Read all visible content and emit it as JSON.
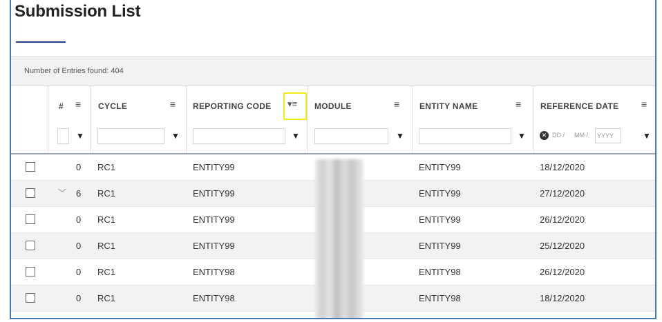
{
  "page": {
    "title": "Submission List"
  },
  "entries": {
    "label": "Number of Entries found:",
    "count": "404"
  },
  "columns": [
    {
      "key": "num",
      "label": "#"
    },
    {
      "key": "cycle",
      "label": "CYCLE"
    },
    {
      "key": "reporting_code",
      "label": "REPORTING CODE"
    },
    {
      "key": "module",
      "label": "MODULE"
    },
    {
      "key": "entity_name",
      "label": "ENTITY NAME"
    },
    {
      "key": "reference_date",
      "label": "REFERENCE DATE"
    }
  ],
  "date_filter": {
    "dd": "DD",
    "mm": "MM",
    "yyyy": "YYYY",
    "sep": "/"
  },
  "icons": {
    "menu": "menu-lines-icon",
    "filter": "funnel-icon",
    "sort_menu": "sort-menu-icon",
    "expand": "chevron-down-icon",
    "clear": "clear-circle-icon"
  },
  "rows": [
    {
      "num": "0",
      "cycle": "RC1",
      "reporting_code": "ENTITY99",
      "entity_name": "ENTITY99",
      "reference_date": "18/12/2020",
      "expandable": false
    },
    {
      "num": "6",
      "cycle": "RC1",
      "reporting_code": "ENTITY99",
      "entity_name": "ENTITY99",
      "reference_date": "27/12/2020",
      "expandable": true
    },
    {
      "num": "0",
      "cycle": "RC1",
      "reporting_code": "ENTITY99",
      "entity_name": "ENTITY99",
      "reference_date": "26/12/2020",
      "expandable": false
    },
    {
      "num": "0",
      "cycle": "RC1",
      "reporting_code": "ENTITY99",
      "entity_name": "ENTITY99",
      "reference_date": "25/12/2020",
      "expandable": false
    },
    {
      "num": "0",
      "cycle": "RC1",
      "reporting_code": "ENTITY98",
      "entity_name": "ENTITY98",
      "reference_date": "26/12/2020",
      "expandable": false
    },
    {
      "num": "0",
      "cycle": "RC1",
      "reporting_code": "ENTITY98",
      "entity_name": "ENTITY98",
      "reference_date": "18/12/2020",
      "expandable": false
    }
  ],
  "colors": {
    "frame_border": "#4a77b4",
    "title_underline": "#1f3f8a",
    "highlight": "#f2ec1f",
    "alt_row": "#f2f2f2"
  }
}
